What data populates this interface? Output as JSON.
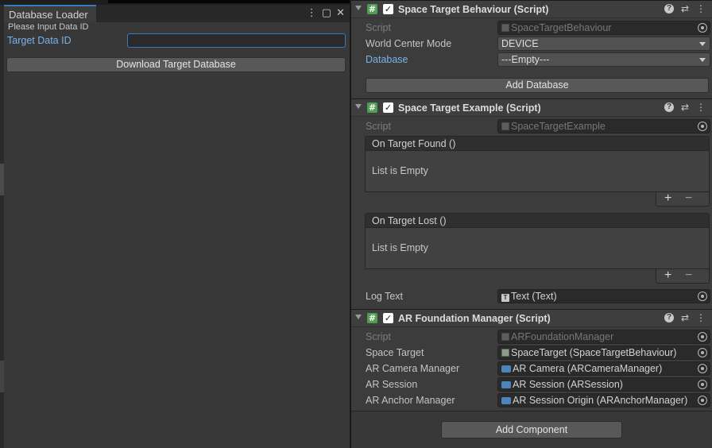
{
  "left_window": {
    "tab_title": "Database Loader",
    "menu_glyph": "⋮",
    "maximize_glyph": "▢",
    "close_glyph": "✕",
    "hint": "Please Input Data ID",
    "field_label": "Target Data ID",
    "field_value": "",
    "download_button": "Download Target Database"
  },
  "inspector": {
    "fold_glyph": "▼",
    "hash_glyph": "#",
    "check_glyph": "✓",
    "help_glyph": "?",
    "preset_glyph": "⇄",
    "more_glyph": "⋮",
    "space_target_behaviour": {
      "title": "Space Target Behaviour (Script)",
      "script_label": "Script",
      "script_value": "SpaceTargetBehaviour",
      "world_center_label": "World Center Mode",
      "world_center_value": "DEVICE",
      "database_label": "Database",
      "database_value": "---Empty---",
      "add_database_button": "Add Database"
    },
    "space_target_example": {
      "title": "Space Target Example (Script)",
      "script_label": "Script",
      "script_value": "SpaceTargetExample",
      "on_found": {
        "header": "On Target Found ()",
        "empty": "List is Empty",
        "plus": "+",
        "minus": "−"
      },
      "on_lost": {
        "header": "On Target Lost ()",
        "empty": "List is Empty",
        "plus": "+",
        "minus": "−"
      },
      "log_text_label": "Log Text",
      "log_text_value": "Text (Text)",
      "text_icon_glyph": "T"
    },
    "ar_foundation_manager": {
      "title": "AR Foundation Manager (Script)",
      "script_label": "Script",
      "script_value": "ARFoundationManager",
      "space_target_label": "Space Target",
      "space_target_value": "SpaceTarget (SpaceTargetBehaviour)",
      "camera_manager_label": "AR Camera Manager",
      "camera_manager_value": "AR Camera (ARCameraManager)",
      "session_label": "AR Session",
      "session_value": "AR Session (ARSession)",
      "anchor_manager_label": "AR Anchor Manager",
      "anchor_manager_value": "AR Session Origin (ARAnchorManager)"
    },
    "add_component_button": "Add Component"
  }
}
